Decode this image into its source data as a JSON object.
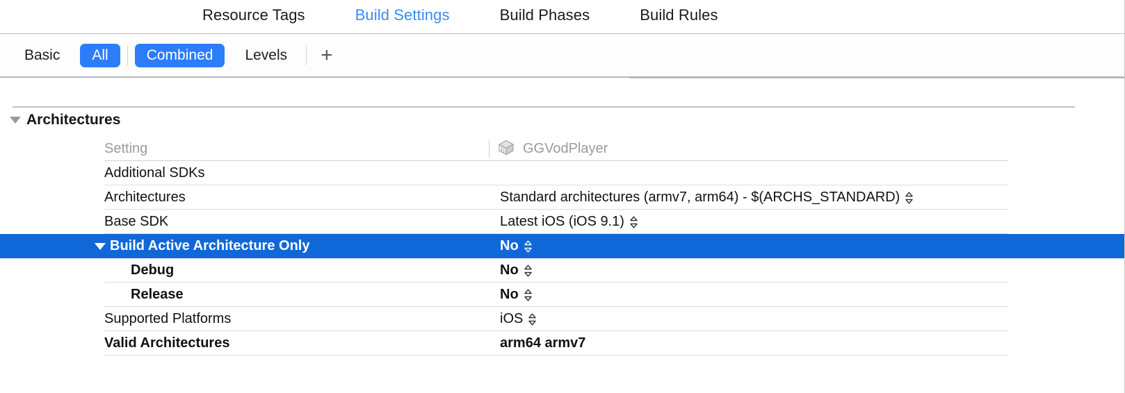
{
  "window": {
    "accent_blue": "#3b8bf0",
    "selection_blue": "#1068d8",
    "pill_blue": "#2d7cfa"
  },
  "tabbar": {
    "tabs": [
      {
        "label": "Resource Tags",
        "active": false
      },
      {
        "label": "Build Settings",
        "active": true
      },
      {
        "label": "Build Phases",
        "active": false
      },
      {
        "label": "Build Rules",
        "active": false
      }
    ]
  },
  "toolbar": {
    "filters": [
      {
        "label": "Basic",
        "selected": false
      },
      {
        "label": "All",
        "selected": true
      },
      {
        "label": "Combined",
        "selected": true
      },
      {
        "label": "Levels",
        "selected": false
      }
    ],
    "add_label": "+",
    "search": {
      "value": "",
      "placeholder": "",
      "icon": "search-icon"
    }
  },
  "settings": {
    "group": {
      "title": "Architectures",
      "expanded": true
    },
    "columns": {
      "setting": "Setting",
      "target": "GGVodPlayer",
      "target_icon": "target-app-icon"
    },
    "rows": [
      {
        "name": "Additional SDKs",
        "value": "",
        "stepper": false,
        "bold_name": false,
        "bold_value": false,
        "child": false,
        "selected": false,
        "disclosure": false
      },
      {
        "name": "Architectures",
        "value": "Standard architectures (armv7, arm64)  -  $(ARCHS_STANDARD)",
        "stepper": true,
        "bold_name": false,
        "bold_value": false,
        "child": false,
        "selected": false,
        "disclosure": false
      },
      {
        "name": "Base SDK",
        "value": "Latest iOS (iOS 9.1)",
        "stepper": true,
        "bold_name": false,
        "bold_value": false,
        "child": false,
        "selected": false,
        "disclosure": false
      },
      {
        "name": "Build Active Architecture Only",
        "value": "No",
        "stepper": true,
        "bold_name": true,
        "bold_value": true,
        "child": false,
        "selected": true,
        "disclosure": true
      },
      {
        "name": "Debug",
        "value": "No",
        "stepper": true,
        "bold_name": true,
        "bold_value": true,
        "child": true,
        "selected": false,
        "disclosure": false
      },
      {
        "name": "Release",
        "value": "No",
        "stepper": true,
        "bold_name": true,
        "bold_value": true,
        "child": true,
        "selected": false,
        "disclosure": false
      },
      {
        "name": "Supported Platforms",
        "value": "iOS",
        "stepper": true,
        "bold_name": false,
        "bold_value": false,
        "child": false,
        "selected": false,
        "disclosure": false
      },
      {
        "name": "Valid Architectures",
        "value": "arm64 armv7",
        "stepper": false,
        "bold_name": true,
        "bold_value": true,
        "child": false,
        "selected": false,
        "disclosure": false
      }
    ]
  }
}
